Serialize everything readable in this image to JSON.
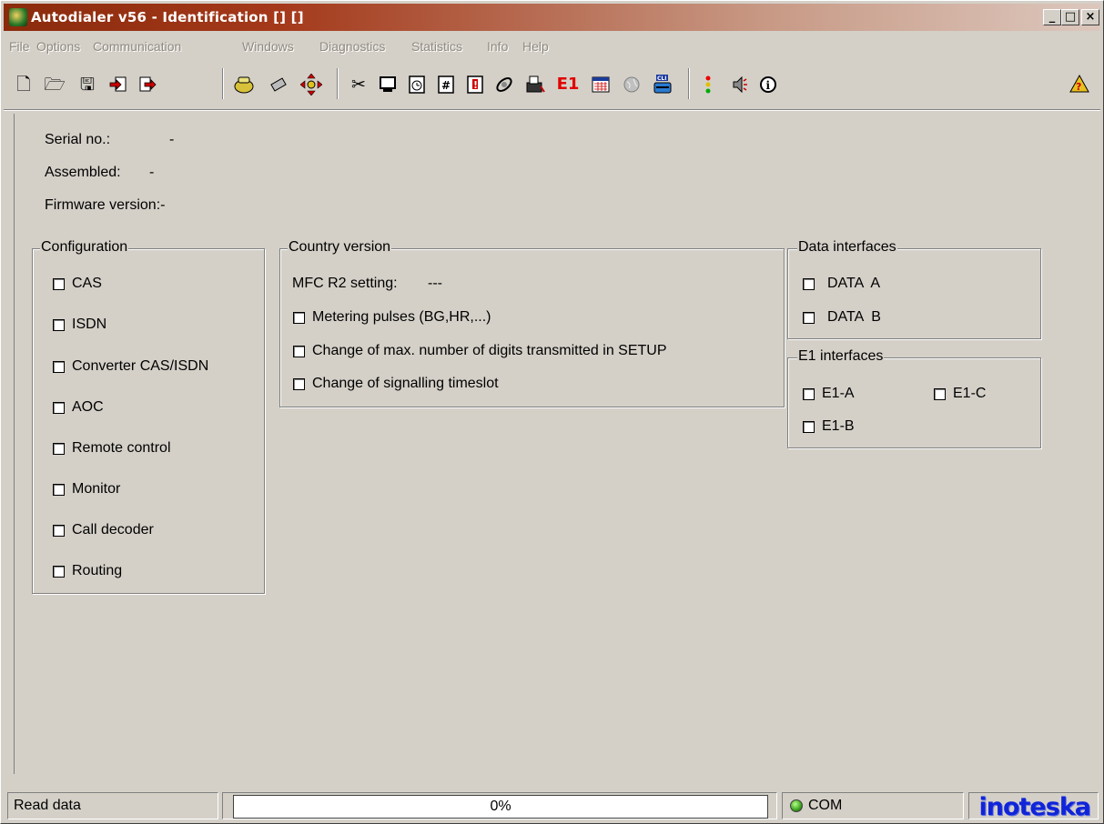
{
  "window": {
    "title": "Autodialer v56 - Identification [] []",
    "controls": [
      "_",
      "□",
      "×"
    ]
  },
  "menu": [
    "File",
    "Options",
    "Communication",
    "Windows",
    "Diagnostics",
    "Statistics",
    "Info",
    "Help"
  ],
  "toolbar": {
    "e1_label": "E1",
    "icons": [
      "new-file-icon",
      "open-folder-icon",
      "save-icon",
      "import-icon",
      "export-icon",
      "phone-icon",
      "chip-icon",
      "move-arrows-icon",
      "scissors-icon",
      "monitor-icon",
      "clock-icon",
      "number-icon",
      "alert-icon",
      "satellite-icon",
      "fax-icon",
      "e1-icon",
      "calendar-icon",
      "globe-icon",
      "cli-phone-icon",
      "traffic-light-icon",
      "speaker-icon",
      "info-icon",
      "help-icon"
    ]
  },
  "info": {
    "serial_label": "Serial no.:",
    "serial_value": "-",
    "assembled_label": "Assembled:",
    "assembled_value": "-",
    "firmware_label": "Firmware version:-"
  },
  "configuration": {
    "title": "Configuration",
    "items": [
      "CAS",
      "ISDN",
      "Converter CAS/ISDN",
      "AOC",
      "Remote control",
      "Monitor",
      "Call decoder",
      "Routing"
    ]
  },
  "country": {
    "title": "Country version",
    "mfc_label": "MFC R2 setting:",
    "mfc_value": "---",
    "items": [
      "Metering pulses (BG,HR,...)",
      "Change of max. number of digits transmitted in SETUP",
      "Change of signalling timeslot"
    ]
  },
  "data_interfaces": {
    "title": "Data interfaces",
    "items": [
      "DATA  A",
      "DATA  B"
    ]
  },
  "e1_interfaces": {
    "title": "E1 interfaces",
    "items": [
      "E1-A",
      "E1-C",
      "E1-B"
    ]
  },
  "statusbar": {
    "status_text": "Read data",
    "progress_text": "0%",
    "progress": 0,
    "com_label": "COM",
    "brand": "inoteska"
  }
}
